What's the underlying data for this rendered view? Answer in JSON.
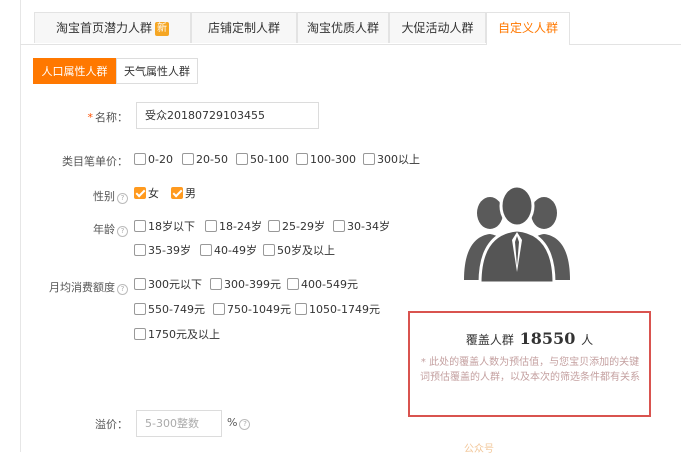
{
  "tabs": [
    {
      "label": "淘宝首页潜力人群",
      "badge": "新"
    },
    {
      "label": "店铺定制人群"
    },
    {
      "label": "淘宝优质人群"
    },
    {
      "label": "大促活动人群"
    },
    {
      "label": "自定义人群",
      "active": true
    }
  ],
  "subtabs": [
    {
      "label": "人口属性人群",
      "active": true
    },
    {
      "label": "天气属性人群"
    }
  ],
  "form": {
    "name_label": "名称：",
    "required_mark": "*",
    "name_value": "受众20180729103455",
    "category_label": "类目笔单价：",
    "category_options": [
      "0-20",
      "20-50",
      "50-100",
      "100-300",
      "300以上"
    ],
    "gender_label": "性别",
    "gender_options": [
      {
        "label": "女",
        "checked": true
      },
      {
        "label": "男",
        "checked": true
      }
    ],
    "age_label": "年龄",
    "age_options": [
      "18岁以下",
      "18-24岁",
      "25-29岁",
      "30-34岁",
      "35-39岁",
      "40-49岁",
      "50岁及以上"
    ],
    "spend_label": "月均消费额度",
    "spend_options": [
      "300元以下",
      "300-399元",
      "400-549元",
      "550-749元",
      "750-1049元",
      "1050-1749元",
      "1750元及以上"
    ],
    "premium_label": "溢价：",
    "premium_placeholder": "5-300整数",
    "premium_unit": "%",
    "help_icon": "?"
  },
  "coverage": {
    "prefix": "覆盖人群",
    "count": "18550",
    "suffix": "人",
    "note": "* 此处的覆盖人数为预估值，与您宝贝添加的关键词预估覆盖的人群，以及本次的筛选条件都有关系"
  },
  "colors": {
    "accent": "#ff7800",
    "highlight_border": "#d9534f",
    "icon_gray": "#555555"
  },
  "watermark": "公众号"
}
